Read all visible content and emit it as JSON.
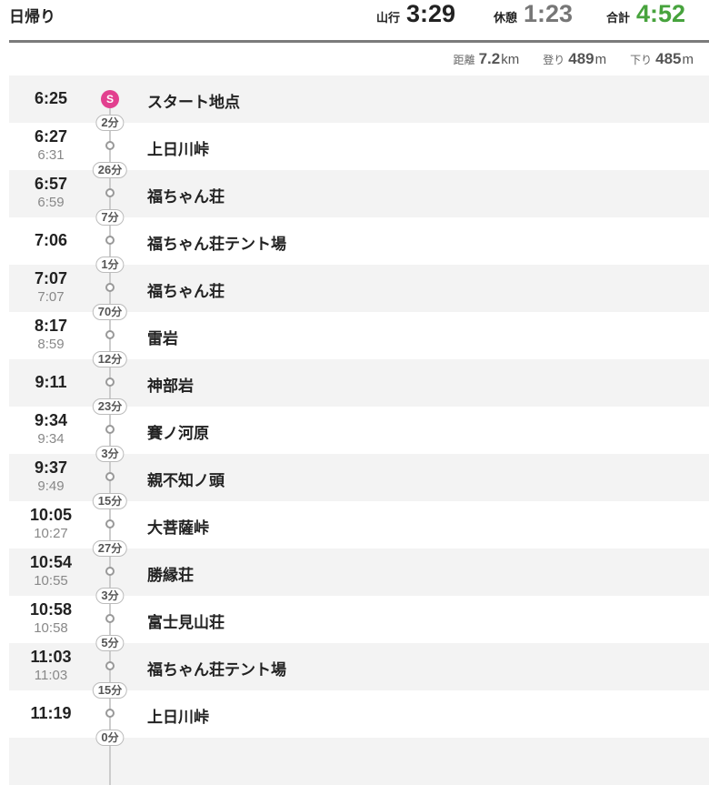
{
  "header": {
    "title": "日帰り",
    "hike_label": "山行",
    "hike_time": "3:29",
    "rest_label": "休憩",
    "rest_time": "1:23",
    "total_label": "合計",
    "total_time": "4:52"
  },
  "summary": {
    "distance_label": "距離",
    "distance_value": "7.2",
    "distance_unit": "km",
    "up_label": "登り",
    "up_value": "489",
    "up_unit": "m",
    "down_label": "下り",
    "down_value": "485",
    "down_unit": "m"
  },
  "duration_unit": "分",
  "timeline": [
    {
      "arrive": "6:25",
      "depart": "",
      "place": "スタート地点",
      "badge": "S"
    },
    {
      "duration": "2",
      "arrive": "6:27",
      "depart": "6:31",
      "place": "上日川峠"
    },
    {
      "duration": "26",
      "arrive": "6:57",
      "depart": "6:59",
      "place": "福ちゃん荘"
    },
    {
      "duration": "7",
      "arrive": "7:06",
      "depart": "",
      "place": "福ちゃん荘テント場"
    },
    {
      "duration": "1",
      "arrive": "7:07",
      "depart": "7:07",
      "place": "福ちゃん荘"
    },
    {
      "duration": "70",
      "arrive": "8:17",
      "depart": "8:59",
      "place": "雷岩"
    },
    {
      "duration": "12",
      "arrive": "9:11",
      "depart": "",
      "place": "神部岩"
    },
    {
      "duration": "23",
      "arrive": "9:34",
      "depart": "9:34",
      "place": "賽ノ河原"
    },
    {
      "duration": "3",
      "arrive": "9:37",
      "depart": "9:49",
      "place": "親不知ノ頭"
    },
    {
      "duration": "15",
      "arrive": "10:05",
      "depart": "10:27",
      "place": "大菩薩峠"
    },
    {
      "duration": "27",
      "arrive": "10:54",
      "depart": "10:55",
      "place": "勝縁荘"
    },
    {
      "duration": "3",
      "arrive": "10:58",
      "depart": "10:58",
      "place": "富士見山荘"
    },
    {
      "duration": "5",
      "arrive": "11:03",
      "depart": "11:03",
      "place": "福ちゃん荘テント場"
    },
    {
      "duration": "15",
      "arrive": "11:19",
      "depart": "",
      "place": "上日川峠"
    },
    {
      "duration": "0"
    }
  ],
  "colors": {
    "start_badge": "#e2408f",
    "total_time": "#47a33d",
    "rest_time": "#777777",
    "row_shade": "#f3f3f3"
  }
}
